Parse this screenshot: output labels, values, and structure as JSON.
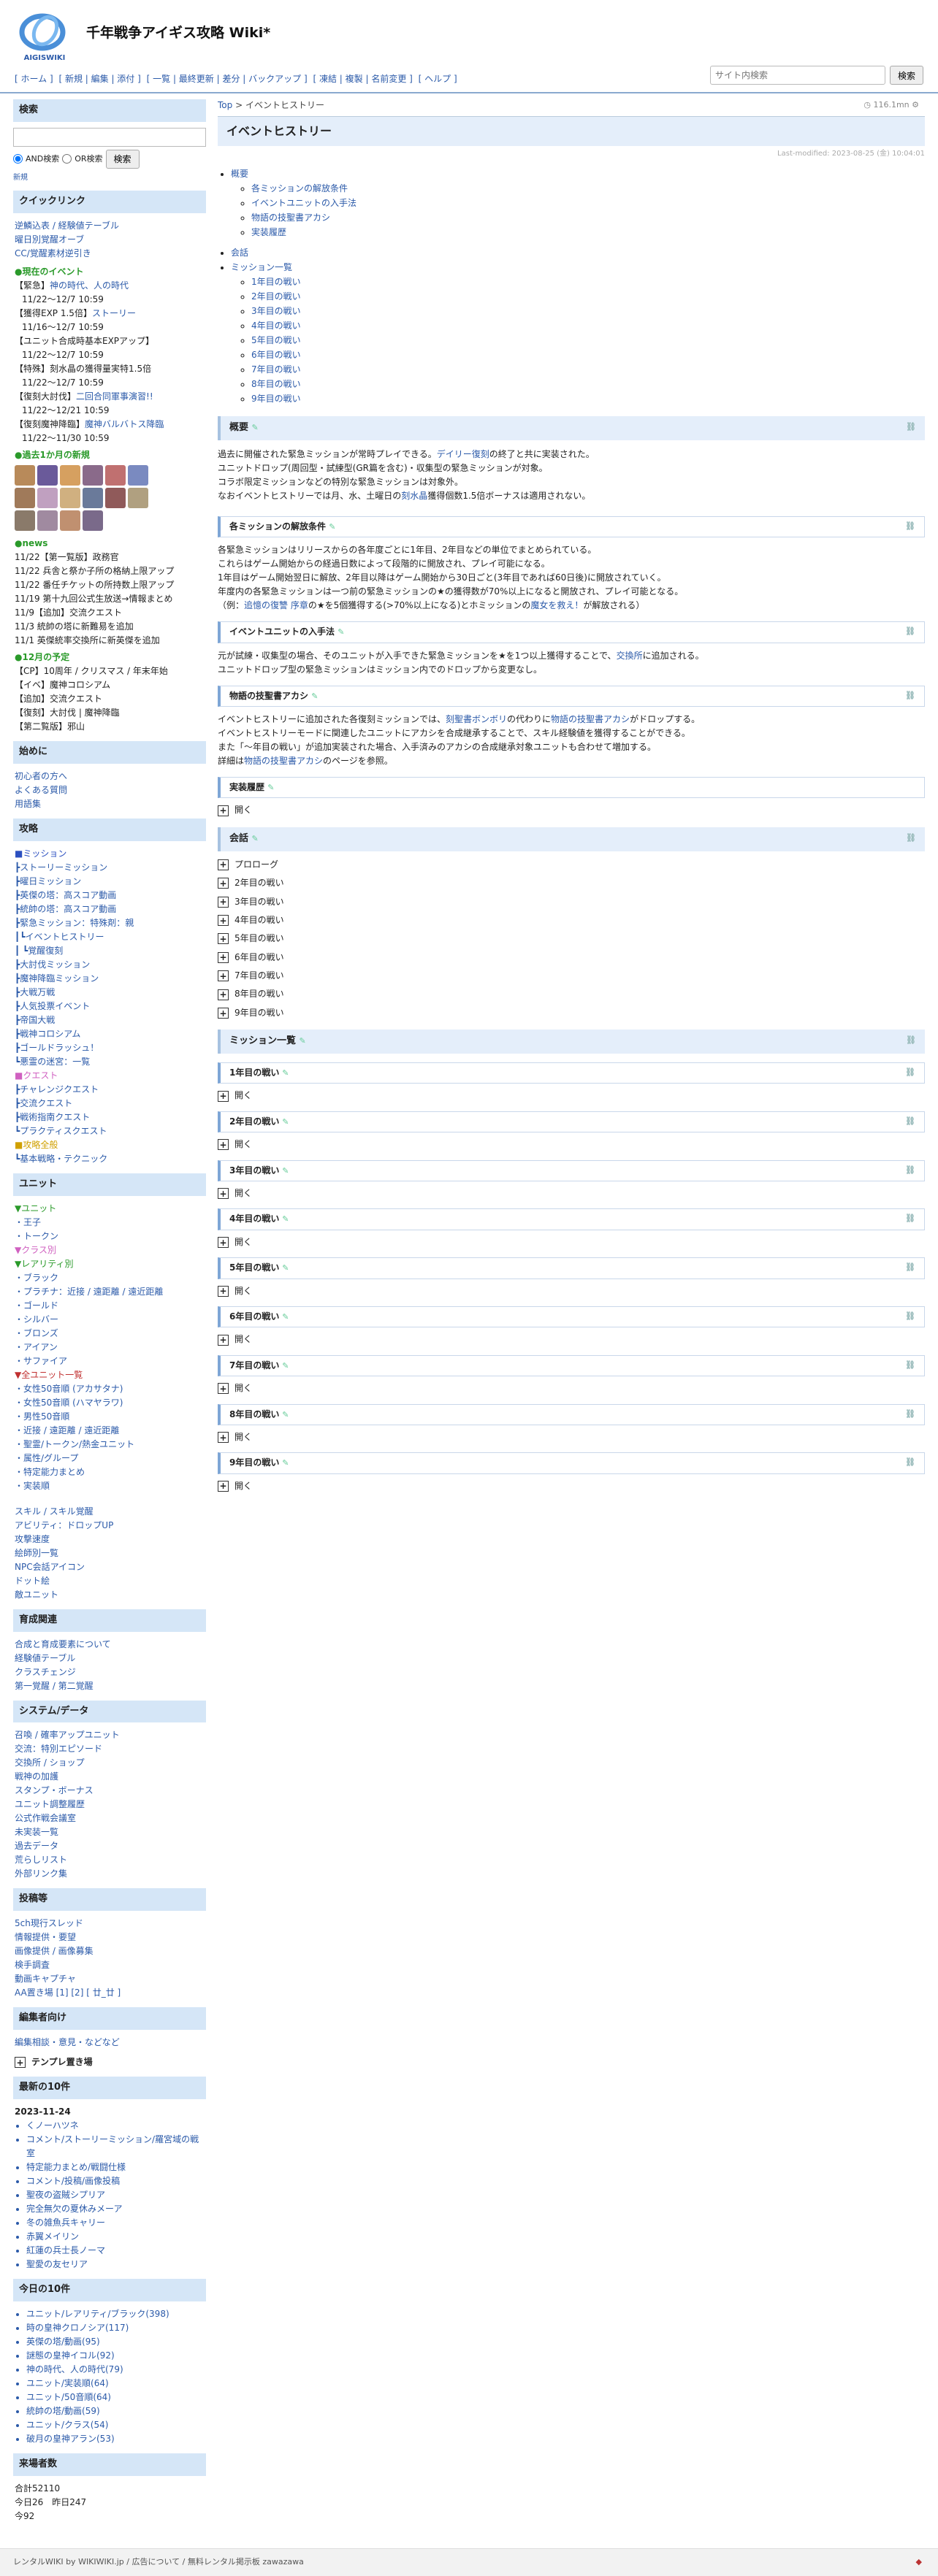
{
  "site": {
    "title": "千年戦争アイギス攻略 Wiki*",
    "logo_text": "AIGISWIKI"
  },
  "topmenu": [
    "[ ホーム ]",
    "[ 新規 | 編集 | 添付 ]",
    "[ 一覧 | 最終更新 | 差分 | バックアップ ]",
    "[ 凍結 | 複製 | 名前変更 ]",
    "[ ヘルプ ]"
  ],
  "site_search": {
    "placeholder": "サイト内検索",
    "button": "検索"
  },
  "sidebar": {
    "search": {
      "title": "検索",
      "and": "AND検索",
      "or": "OR検索",
      "button": "検索",
      "new": "新規"
    },
    "quick": {
      "title": "クイックリンク",
      "links": [
        "逆鱗込表 / 経験値テーブル",
        "曜日別覚醒オーブ",
        "CC/覚醒素材逆引き"
      ]
    },
    "events_title": "●現在のイベント",
    "events": [
      [
        "【緊急】",
        "神の時代、人の時代"
      ],
      [
        "",
        "11/22～12/7 10:59"
      ],
      [
        "【獲得EXP 1.5倍】",
        "ストーリー"
      ],
      [
        "",
        "11/16～12/7 10:59"
      ],
      [
        "【ユニット合成時基本EXPアップ】",
        ""
      ],
      [
        "",
        "11/22～12/7 10:59"
      ],
      [
        "【特殊】刻水晶の獲得量実特1.5倍",
        ""
      ],
      [
        "",
        "11/22～12/7 10:59"
      ],
      [
        "【復刻大討伐】",
        "二回合同軍事演習!!"
      ],
      [
        "",
        "11/22～12/21 10:59"
      ],
      [
        "【復刻魔神降臨】",
        "魔神バルバトス降臨"
      ],
      [
        "",
        "11/22～11/30 10:59"
      ]
    ],
    "recent_title": "●過去1か月の新規",
    "news_title": "●news",
    "news": [
      "11/22【第一覧版】政務官",
      "11/22 兵舎と祭か子所の格納上限アップ",
      "11/22 番任チケットの所持数上限アップ",
      "11/19 第十九回公式生放送→情報まとめ",
      "11/9【追加】交流クエスト",
      "11/3 統帥の塔に新難易を追加",
      "11/1 英傑統率交換所に新英傑を追加"
    ],
    "dec_title": "●12月の予定",
    "dec": [
      "【CP】10周年 / クリスマス / 年末年始",
      "【イベ】魔神コロシアム",
      "【追加】交流クエスト",
      "【復刻】大討伐 | 魔神降臨",
      "【第二覧版】邪山"
    ],
    "start": {
      "title": "始めに",
      "links": [
        "初心者の方へ",
        "よくある質問",
        "用語集"
      ]
    },
    "strategy": {
      "title": "攻略",
      "head": "■ミッション",
      "items": [
        "┣ストーリーミッション",
        "┣曜日ミッション",
        "┣英傑の塔：高スコア動画",
        "┣統帥の塔：高スコア動画",
        "┣緊急ミッション：特殊剤：親",
        "┃┗イベントヒストリー",
        "┃ ┗覚醒復刻",
        "┣大討伐ミッション",
        "┣魔神降臨ミッション",
        "┣大戦万戦",
        "┣人気投票イベント",
        "┣帝国大戦",
        "┣戦神コロシアム",
        "┣ゴールドラッシュ！",
        "┗悪霊の迷宮：一覧"
      ],
      "quest_head": "■クエスト",
      "quests": [
        "┣チャレンジクエスト",
        "┣交流クエスト",
        "┣戦術指南クエスト",
        "┗プラクティスクエスト"
      ],
      "guide_head": "■攻略全般",
      "guides": [
        "┗基本戦略・テクニック"
      ]
    },
    "unit": {
      "title": "ユニット",
      "unit_head": "▼ユニット",
      "u1": [
        "・王子",
        "・トークン"
      ],
      "class_head": "▼クラス別",
      "rarity_head": "▼レアリティ別",
      "rarity": [
        "・ブラック",
        "・プラチナ：近接 / 遠距離 / 遠近距離",
        "・ゴールド",
        "・シルバー",
        "・ブロンズ",
        "・アイアン",
        "・サファイア"
      ],
      "all_head": "▼全ユニット一覧",
      "all": [
        "・女性50音順 (アカサタナ)",
        "・女性50音順 (ハマヤラワ)",
        "・男性50音順",
        "・近接 / 遠距離 / 遠近距離",
        "・聖霊/トークン/熱金ユニット",
        "・属性/グループ",
        "・特定能力まとめ",
        "・実装順"
      ],
      "misc": [
        "スキル / スキル覚醒",
        "アビリティ：ドロップUP",
        "攻撃速度",
        "絵師別一覧",
        "NPC会話アイコン",
        "ドット絵",
        "敵ユニット"
      ]
    },
    "growth": {
      "title": "育成関連",
      "links": [
        "合成と育成要素について",
        "経験値テーブル",
        "クラスチェンジ",
        "第一覚醒 / 第二覚醒"
      ]
    },
    "system": {
      "title": "システム/データ",
      "links": [
        "召喚 / 確率アップユニット",
        "交流：特別エピソード",
        "交換所 / ショップ",
        "戦神の加護",
        "スタンプ・ボーナス",
        "ユニット調整履歴",
        "公式作戦会議室",
        "未実装一覧",
        "過去データ",
        "荒らしリスト",
        "外部リンク集"
      ]
    },
    "post": {
      "title": "投稿等",
      "links": [
        "5ch現行スレッド",
        "情報提供・要望",
        "画像提供 / 画像募集",
        "検手調査",
        "動画キャプチャ"
      ],
      "aa": "AA置き場 [1] [2] [ 廿_廿 ]"
    },
    "editor": {
      "title": "編集者向け",
      "links": [
        "編集相談・意見・などなど"
      ],
      "template": "テンプレ置き場"
    },
    "latest": {
      "title": "最新の10件",
      "date": "2023-11-24",
      "items": [
        "くノーハツネ",
        "コメント/ストーリーミッション/羅宮域の戦室",
        "特定能力まとめ/戦闘仕様",
        "コメント/投稿/画像投稿",
        "聖夜の盗賊シプリア",
        "完全無欠の夏休みメーア",
        "冬の雑魚兵キャリー",
        "赤翼メイリン",
        "紅蓮の兵士長ノーマ",
        "聖愛の友セリア"
      ]
    },
    "today": {
      "title": "今日の10件",
      "items": [
        "ユニット/レアリティ/ブラック(398)",
        "時の皇神クロノシア(117)",
        "英傑の塔/動画(95)",
        "謎態の皇神イコル(92)",
        "神の時代、人の時代(79)",
        "ユニット/実装順(64)",
        "ユニット/50音順(64)",
        "統帥の塔/動画(59)",
        "ユニット/クラス(54)",
        "破月の皇神アラン(53)"
      ]
    },
    "visitors": {
      "title": "来場者数",
      "lines": [
        "合計52110",
        "今日26　昨日247",
        "今92"
      ]
    }
  },
  "main": {
    "crumb_top": "Top",
    "crumb_sep": " > ",
    "crumb_page": "イベントヒストリー",
    "views": "116.1mn",
    "title": "イベントヒストリー",
    "lastmod": "Last-modified: 2023-08-25 (金) 10:04:01",
    "toc": {
      "l1": "概要",
      "l1sub": [
        "各ミッションの解放条件",
        "イベントユニットの入手法",
        "物語の技聖書アカシ",
        "実装履歴"
      ],
      "l2": "会話",
      "l3": "ミッション一覧",
      "l3sub": [
        "1年目の戦い",
        "2年目の戦い",
        "3年目の戦い",
        "4年目の戦い",
        "5年目の戦い",
        "6年目の戦い",
        "7年目の戦い",
        "8年目の戦い",
        "9年目の戦い"
      ]
    },
    "overview": {
      "h": "概要",
      "p": [
        "過去に開催された緊急ミッションが常時プレイできる。",
        "デイリー復刻",
        "の終了と共に実装された。",
        "ユニットドロップ(周回型・試練型(GR篇を含む)・収集型の緊急ミッションが対象。",
        "コラボ限定ミッションなどの特別な緊急ミッションは対象外。",
        "なおイベントヒストリーでは月、水、土曜日の",
        "刻水晶",
        "獲得個数1.5倍ボーナスは適用されない。"
      ]
    },
    "release": {
      "h": "各ミッションの解放条件",
      "p": [
        "各緊急ミッションはリリースからの各年度ごとに1年目、2年目などの単位でまとめられている。",
        "これらはゲーム開始からの経過日数によって段階的に開放され、プレイ可能になる。",
        "1年目はゲーム開始翌日に解放、2年目以降はゲーム開始から30日ごと(3年目であれば60日後)に開放されていく。",
        "年度内の各緊急ミッションは一つ前の緊急ミッションの★の獲得数が70%以上になると開放され、プレイ可能となる。",
        "（例：",
        "追憶の復讐 序章",
        "の★を5個獲得する(>70%以上になる)とホミッションの",
        "魔女を救え！",
        "が解放される）"
      ]
    },
    "unitget": {
      "h": "イベントユニットの入手法",
      "p": [
        "元が試練・収集型の場合、そのユニットが入手できた緊急ミッションを★を1つ以上獲得することで、",
        "交換所",
        "に追加される。",
        "ユニットドロップ型の緊急ミッションはミッション内でのドロップから変更なし。"
      ]
    },
    "akashi": {
      "h": "物語の技聖書アカシ",
      "p": [
        "イベントヒストリーに追加された各復刻ミッションでは、",
        "刻聖書ボンボリ",
        "の代わりに",
        "物語の技聖書アカシ",
        "がドロップする。",
        "イベントヒストリーモードに関連したユニットにアカシを合成継承することで、スキル経験値を獲得することができる。",
        "また「〜年目の戦い」が追加実装された場合、入手済みのアカシの合成継承対象ユニットも合わせて増加する。",
        "詳細は",
        "物語の技聖書アカシ",
        "のページを参照。"
      ]
    },
    "history": {
      "h": "実装履歴",
      "open": "開く"
    },
    "talk": {
      "h": "会話",
      "items": [
        "プロローグ",
        "2年目の戦い",
        "3年目の戦い",
        "4年目の戦い",
        "5年目の戦い",
        "6年目の戦い",
        "7年目の戦い",
        "8年目の戦い",
        "9年目の戦い"
      ]
    },
    "missions": {
      "h": "ミッション一覧",
      "items": [
        "1年目の戦い",
        "2年目の戦い",
        "3年目の戦い",
        "4年目の戦い",
        "5年目の戦い",
        "6年目の戦い",
        "7年目の戦い",
        "8年目の戦い",
        "9年目の戦い"
      ],
      "open": "開く"
    }
  },
  "footer": {
    "text": "レンタルWIKI by WIKIWIKI.jp / 広告について / 無料レンタル掲示板 zawazawa"
  }
}
